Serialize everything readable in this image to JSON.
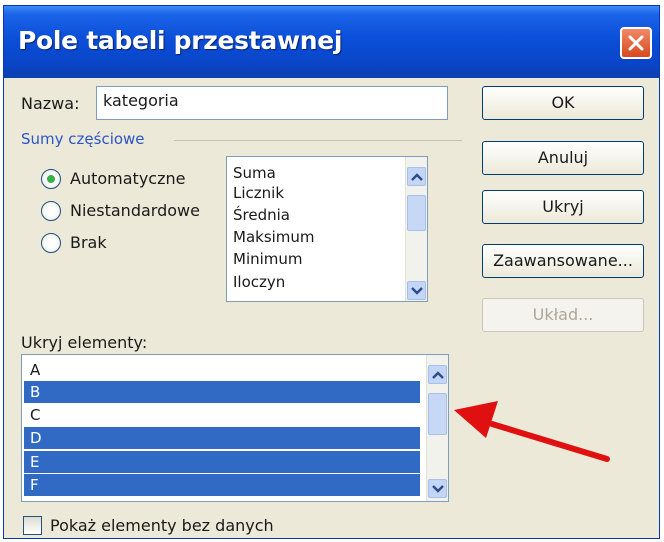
{
  "window": {
    "title": "Pole tabeli przestawnej"
  },
  "form": {
    "name_label": "Nazwa:",
    "name_value": "kategoria"
  },
  "subtotals": {
    "group_label": "Sumy częściowe",
    "options": [
      "Automatyczne",
      "Niestandardowe",
      "Brak"
    ],
    "selected": "Automatyczne",
    "functions": [
      "Suma",
      "Licznik",
      "Średnia",
      "Maksimum",
      "Minimum",
      "Iloczyn"
    ]
  },
  "buttons": {
    "ok": "OK",
    "cancel": "Anuluj",
    "hide": "Ukryj",
    "advanced": "Zaawansowane...",
    "layout": "Układ..."
  },
  "hide_items": {
    "label": "Ukryj elementy:",
    "items": [
      {
        "text": "A",
        "selected": false
      },
      {
        "text": "B",
        "selected": true
      },
      {
        "text": "C",
        "selected": false
      },
      {
        "text": "D",
        "selected": true
      },
      {
        "text": "E",
        "selected": true
      },
      {
        "text": "F",
        "selected": true
      }
    ]
  },
  "show_no_data": {
    "label": "Pokaż elementy bez danych",
    "checked": false
  },
  "colors": {
    "selection": "#316ac5",
    "annotation_arrow": "#e01010",
    "title_bar": "#0b4fd8"
  }
}
